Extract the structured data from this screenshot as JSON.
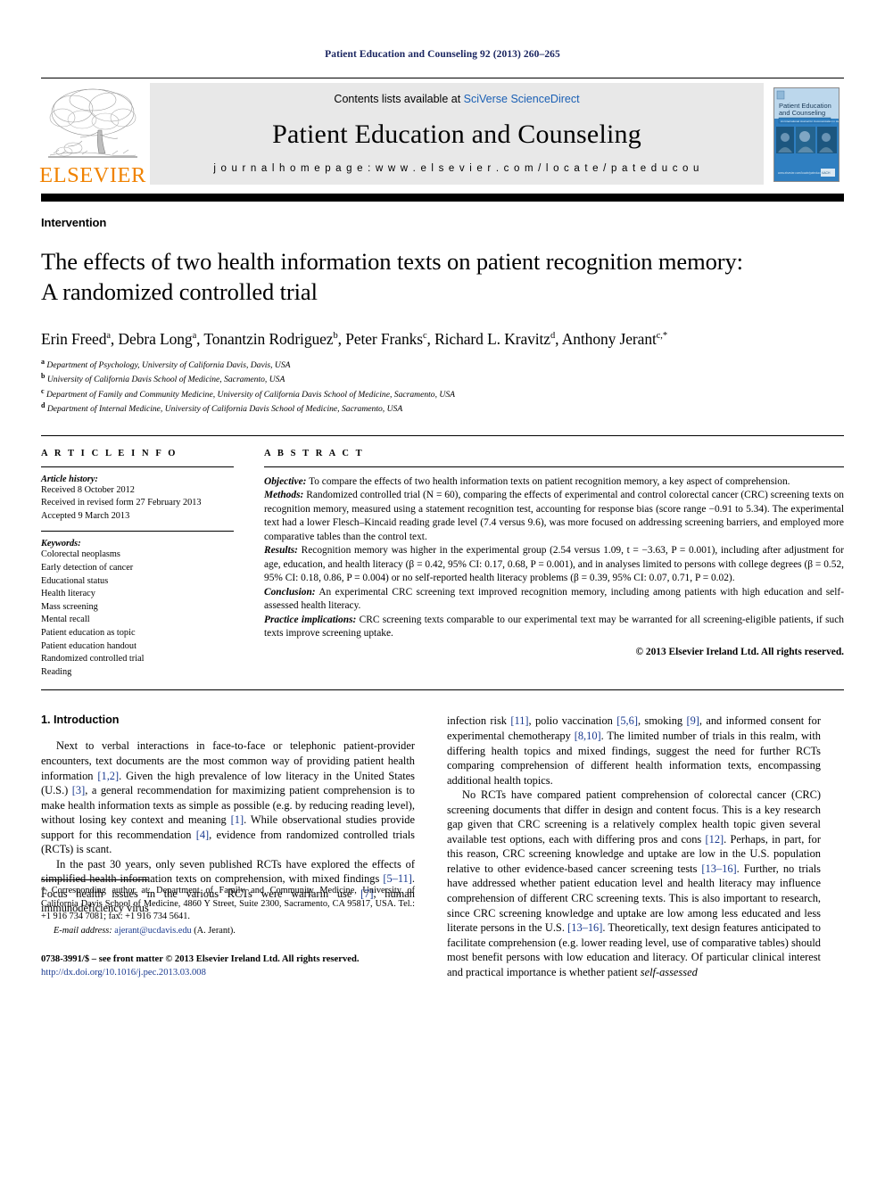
{
  "running_head": "Patient Education and Counseling 92 (2013) 260–265",
  "masthead": {
    "publisher_name": "ELSEVIER",
    "contents_prefix": "Contents lists available at ",
    "contents_link": "SciVerse ScienceDirect",
    "journal_title": "Patient Education and Counseling",
    "homepage": "j o u r n a l   h o m e p a g e :   w w w . e l s e v i e r . c o m / l o c a t e / p a t e d u c o u",
    "cover_title_line1": "Patient Education",
    "cover_title_line2": "and Counseling",
    "cover_subtitle": "An International Journal for Communication in Healthcare"
  },
  "article": {
    "kicker": "Intervention",
    "title_line1": "The effects of two health information texts on patient recognition memory:",
    "title_line2": "A randomized controlled trial",
    "authors": [
      {
        "name": "Erin Freed",
        "sup": "a"
      },
      {
        "name": "Debra Long",
        "sup": "a"
      },
      {
        "name": "Tonantzin Rodriguez",
        "sup": "b"
      },
      {
        "name": "Peter Franks",
        "sup": "c"
      },
      {
        "name": "Richard L. Kravitz",
        "sup": "d"
      },
      {
        "name": "Anthony Jerant",
        "sup": "c,*"
      }
    ],
    "affiliations": [
      {
        "mark": "a",
        "text": "Department of Psychology, University of California Davis, Davis, USA"
      },
      {
        "mark": "b",
        "text": "University of California Davis School of Medicine, Sacramento, USA"
      },
      {
        "mark": "c",
        "text": "Department of Family and Community Medicine, University of California Davis School of Medicine, Sacramento, USA"
      },
      {
        "mark": "d",
        "text": "Department of Internal Medicine, University of California Davis School of Medicine, Sacramento, USA"
      }
    ]
  },
  "article_info": {
    "heading": "A R T I C L E   I N F O",
    "history_label": "Article history:",
    "history": [
      "Received 8 October 2012",
      "Received in revised form 27 February 2013",
      "Accepted 9 March 2013"
    ],
    "keywords_label": "Keywords:",
    "keywords": [
      "Colorectal neoplasms",
      "Early detection of cancer",
      "Educational status",
      "Health literacy",
      "Mass screening",
      "Mental recall",
      "Patient education as topic",
      "Patient education handout",
      "Randomized controlled trial",
      "Reading"
    ]
  },
  "abstract": {
    "heading": "A B S T R A C T",
    "sections": [
      {
        "label": "Objective:",
        "text": " To compare the effects of two health information texts on patient recognition memory, a key aspect of comprehension."
      },
      {
        "label": "Methods:",
        "text": " Randomized controlled trial (N = 60), comparing the effects of experimental and control colorectal cancer (CRC) screening texts on recognition memory, measured using a statement recognition test, accounting for response bias (score range −0.91 to 5.34). The experimental text had a lower Flesch–Kincaid reading grade level (7.4 versus 9.6), was more focused on addressing screening barriers, and employed more comparative tables than the control text."
      },
      {
        "label": "Results:",
        "text": " Recognition memory was higher in the experimental group (2.54 versus 1.09, t = −3.63, P = 0.001), including after adjustment for age, education, and health literacy (β = 0.42, 95% CI: 0.17, 0.68, P = 0.001), and in analyses limited to persons with college degrees (β = 0.52, 95% CI: 0.18, 0.86, P = 0.004) or no self-reported health literacy problems (β = 0.39, 95% CI: 0.07, 0.71, P = 0.02)."
      },
      {
        "label": "Conclusion:",
        "text": " An experimental CRC screening text improved recognition memory, including among patients with high education and self-assessed health literacy."
      },
      {
        "label": "Practice implications:",
        "text": " CRC screening texts comparable to our experimental text may be warranted for all screening-eligible patients, if such texts improve screening uptake."
      }
    ],
    "copyright": "© 2013 Elsevier Ireland Ltd. All rights reserved."
  },
  "body": {
    "intro_heading": "1. Introduction",
    "left_paragraphs": [
      "Next to verbal interactions in face-to-face or telephonic patient-provider encounters, text documents are the most common way of providing patient health information [1,2]. Given the high prevalence of low literacy in the United States (U.S.) [3], a general recommendation for maximizing patient comprehension is to make health information texts as simple as possible (e.g. by reducing reading level), without losing key context and meaning [1]. While observational studies provide support for this recommendation [4], evidence from randomized controlled trials (RCTs) is scant.",
      "In the past 30 years, only seven published RCTs have explored the effects of simplified health information texts on comprehension, with mixed findings [5–11]. Focus health issues in the various RCTs were warfarin use [7], human immunodeficiency virus"
    ],
    "right_paragraphs": [
      "infection risk [11], polio vaccination [5,6], smoking [9], and informed consent for experimental chemotherapy [8,10]. The limited number of trials in this realm, with differing health topics and mixed findings, suggest the need for further RCTs comparing comprehension of different health information texts, encompassing additional health topics.",
      "No RCTs have compared patient comprehension of colorectal cancer (CRC) screening documents that differ in design and content focus. This is a key research gap given that CRC screening is a relatively complex health topic given several available test options, each with differing pros and cons [12]. Perhaps, in part, for this reason, CRC screening knowledge and uptake are low in the U.S. population relative to other evidence-based cancer screening tests [13–16]. Further, no trials have addressed whether patient education level and health literacy may influence comprehension of different CRC screening texts. This is also important to research, since CRC screening knowledge and uptake are low among less educated and less literate persons in the U.S. [13–16]. Theoretically, text design features anticipated to facilitate comprehension (e.g. lower reading level, use of comparative tables) should most benefit persons with low education and literacy. Of particular clinical interest and practical importance is whether patient self-assessed"
    ]
  },
  "footnote": {
    "corresponding": "* Corresponding author at: Department of Family and Community Medicine, University of California Davis School of Medicine, 4860 Y Street, Suite 2300, Sacramento, CA 95817, USA. Tel.: +1 916 734 7081; fax: +1 916 734 5641.",
    "email_label": "E-mail address:",
    "email": "ajerant@ucdavis.edu",
    "email_suffix": " (A. Jerant).",
    "issn_line": "0738-3991/$ – see front matter © 2013 Elsevier Ireland Ltd. All rights reserved.",
    "doi": "http://dx.doi.org/10.1016/j.pec.2013.03.008"
  },
  "colors": {
    "running_head": "#1a2560",
    "link": "#1a3a8f",
    "elsevier_orange": "#F08200",
    "masthead_bg": "#e8e8e8"
  }
}
